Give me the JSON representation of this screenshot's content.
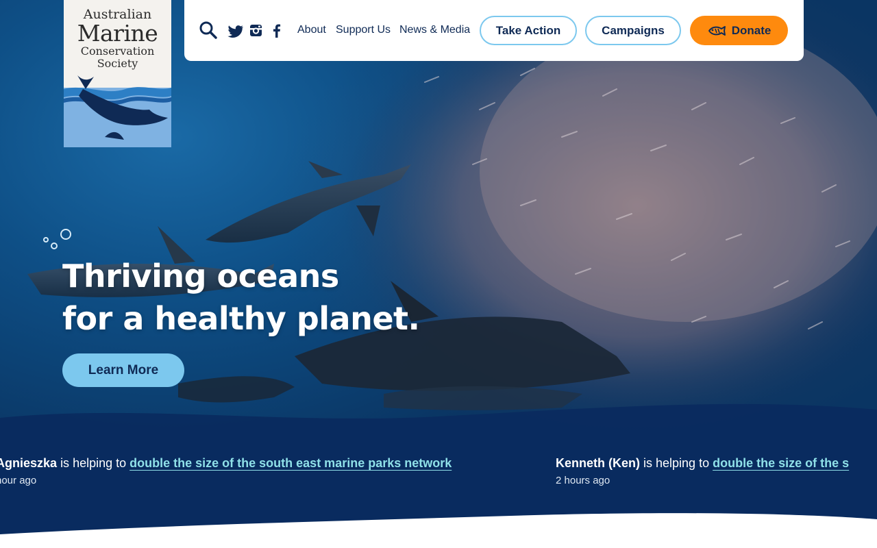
{
  "logo": {
    "line1": "Australian",
    "line2": "Marine",
    "line3": "Conservation",
    "line4": "Society"
  },
  "nav": {
    "links": [
      "About",
      "Support Us",
      "News & Media"
    ],
    "take_action": "Take Action",
    "campaigns": "Campaigns",
    "donate": "Donate",
    "social_icons": [
      "twitter-icon",
      "instagram-icon",
      "facebook-icon"
    ]
  },
  "hero": {
    "headline_line1": "Thriving oceans",
    "headline_line2": "for a healthy planet.",
    "cta": "Learn More"
  },
  "ticker": [
    {
      "name": "Agnieszka",
      "mid": "is helping to",
      "link": "double the size of the south east marine parks network",
      "time": "hour ago"
    },
    {
      "name": "Kenneth (Ken)",
      "mid": "is helping to",
      "link": "double the size of the s",
      "time": "2 hours ago"
    }
  ],
  "colors": {
    "navy": "#0f2a55",
    "sky": "#7cc8ee",
    "donate_orange": "#fe8a0e",
    "ticker_link": "#8fe0e8",
    "band": "#0a2a5e"
  }
}
